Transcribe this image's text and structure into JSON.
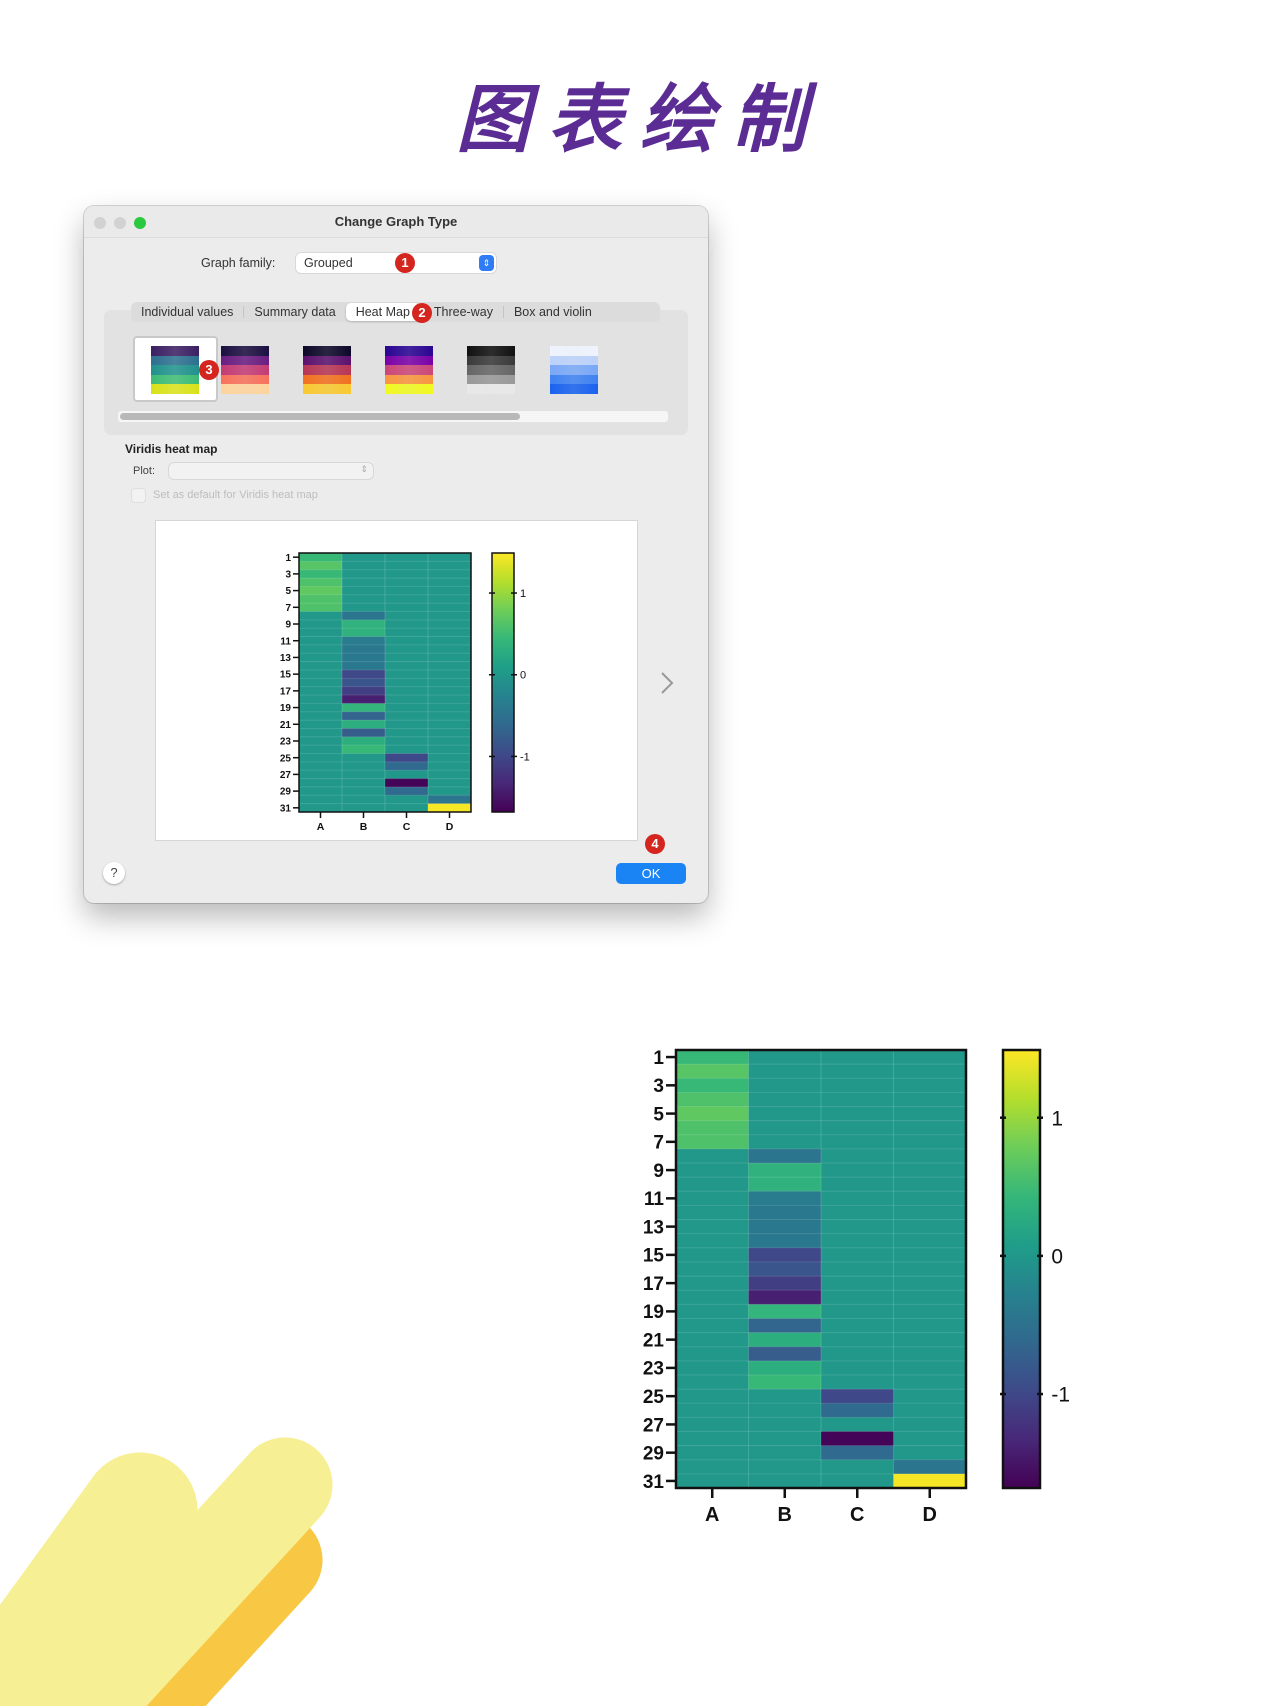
{
  "page_title": "图表绘制",
  "dialog": {
    "title": "Change Graph Type",
    "graph_family_label": "Graph family:",
    "graph_family_value": "Grouped",
    "tabs": [
      {
        "label": "Individual values"
      },
      {
        "label": "Summary data"
      },
      {
        "label": "Heat Map",
        "selected": true
      },
      {
        "label": "Three-way"
      },
      {
        "label": "Box and violin"
      }
    ],
    "thumbnails": [
      {
        "name": "viridis",
        "selected": true,
        "colors": [
          "#3b1f63",
          "#2c6f8e",
          "#21918c",
          "#3dbb74",
          "#d8e219"
        ]
      },
      {
        "name": "magma",
        "colors": [
          "#1c1042",
          "#6b1d81",
          "#c43c75",
          "#f7725c",
          "#fdd49d"
        ]
      },
      {
        "name": "inferno",
        "colors": [
          "#0d0829",
          "#5c126e",
          "#b73655",
          "#f1711f",
          "#f8c932"
        ]
      },
      {
        "name": "plasma",
        "colors": [
          "#2a0593",
          "#7a02a8",
          "#cb4778",
          "#f89540",
          "#f0f921"
        ]
      },
      {
        "name": "grayscale",
        "colors": [
          "#111111",
          "#3a3a3a",
          "#666666",
          "#999999",
          "#e8e8e8"
        ]
      },
      {
        "name": "blues",
        "colors": [
          "#eef3fd",
          "#bcd2fa",
          "#7aa8f7",
          "#3f82f2",
          "#1a62ee"
        ]
      }
    ],
    "section_title": "Viridis heat map",
    "plot_label": "Plot:",
    "plot_value": "",
    "default_checkbox_label": "Set as default for Viridis heat map",
    "default_checkbox_checked": false,
    "help_label": "?",
    "ok_label": "OK",
    "next_icon": "chevron-right-icon",
    "annotation_badges": [
      "1",
      "2",
      "3",
      "4"
    ]
  },
  "colors": {
    "accent": "#1b84f5",
    "badge": "#d5251f",
    "title": "#5b2c93"
  },
  "chart_data": {
    "type": "heatmap",
    "colormap": "viridis",
    "columns": [
      "A",
      "B",
      "C",
      "D"
    ],
    "rows": [
      1,
      2,
      3,
      4,
      5,
      6,
      7,
      8,
      9,
      10,
      11,
      12,
      13,
      14,
      15,
      16,
      17,
      18,
      19,
      20,
      21,
      22,
      23,
      24,
      25,
      26,
      27,
      28,
      29,
      30,
      31
    ],
    "row_tick_labels": [
      "1",
      "3",
      "5",
      "7",
      "9",
      "11",
      "13",
      "15",
      "17",
      "19",
      "21",
      "23",
      "25",
      "27",
      "29",
      "31"
    ],
    "values": [
      [
        0.45,
        0,
        0,
        0
      ],
      [
        0.65,
        0,
        0,
        0
      ],
      [
        0.45,
        0,
        0,
        0
      ],
      [
        0.6,
        0,
        0,
        0
      ],
      [
        0.7,
        0,
        0,
        0
      ],
      [
        0.6,
        0,
        0,
        0
      ],
      [
        0.6,
        0,
        0,
        0
      ],
      [
        0,
        -0.45,
        0,
        0
      ],
      [
        0,
        0.35,
        0,
        0
      ],
      [
        0,
        0.35,
        0,
        0
      ],
      [
        0,
        -0.35,
        0,
        0
      ],
      [
        0,
        -0.4,
        0,
        0
      ],
      [
        0,
        -0.4,
        0,
        0
      ],
      [
        0,
        -0.4,
        0,
        0
      ],
      [
        0,
        -1.0,
        0,
        0
      ],
      [
        0,
        -0.85,
        0,
        0
      ],
      [
        0,
        -1.1,
        0,
        0
      ],
      [
        0,
        -1.4,
        0,
        0
      ],
      [
        0,
        0.4,
        0,
        0
      ],
      [
        0,
        -0.65,
        0,
        0
      ],
      [
        0,
        0.3,
        0,
        0
      ],
      [
        0,
        -0.75,
        0,
        0
      ],
      [
        0,
        0.3,
        0,
        0
      ],
      [
        0,
        0.45,
        0,
        0
      ],
      [
        0,
        0,
        -1.0,
        0
      ],
      [
        0,
        0,
        -0.6,
        0
      ],
      [
        0,
        0,
        0,
        0
      ],
      [
        0,
        0,
        -1.65,
        0
      ],
      [
        0,
        0,
        -0.6,
        0
      ],
      [
        0,
        0,
        0,
        -0.45
      ],
      [
        0,
        0,
        0,
        1.45
      ]
    ],
    "colorbar_range": [
      -1.68,
      1.49
    ],
    "colorbar_ticks": [
      "1",
      "0",
      "-1"
    ],
    "colorbar_tick_values": [
      1,
      0,
      -1
    ]
  }
}
